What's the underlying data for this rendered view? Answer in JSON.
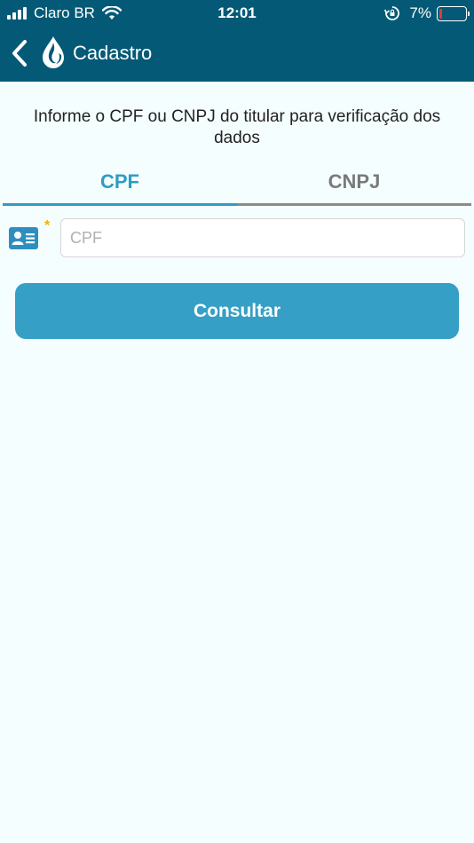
{
  "status_bar": {
    "carrier": "Claro BR",
    "time": "12:01",
    "battery_percent": "7%",
    "battery_level": 0.07
  },
  "nav": {
    "back_icon": "chevron-left-icon",
    "logo_icon": "water-drop-flame-icon",
    "title": "Cadastro"
  },
  "instruction": "Informe o CPF ou CNPJ do titular para verificação dos dados",
  "tabs": [
    {
      "label": "CPF",
      "active": true
    },
    {
      "label": "CNPJ",
      "active": false
    }
  ],
  "form": {
    "field_icon": "id-card-icon",
    "required_mark": "*",
    "cpf_value": "",
    "cpf_placeholder": "CPF"
  },
  "actions": {
    "consultar_label": "Consultar"
  },
  "colors": {
    "header_bg": "#045a76",
    "accent": "#2d9dc2",
    "button": "#369fc5",
    "required": "#f2b200",
    "background": "#f5fefe"
  }
}
